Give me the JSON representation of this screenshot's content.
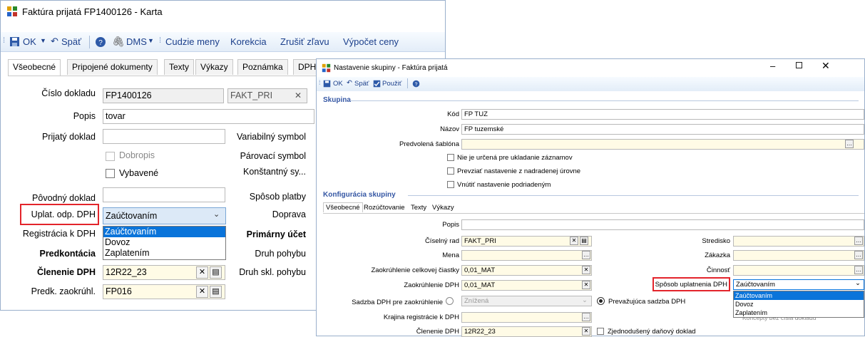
{
  "win1": {
    "title": "Faktúra prijatá FP1400126 - Karta",
    "toolbar": {
      "ok": "OK",
      "back": "Späť",
      "dms": "DMS",
      "foreign": "Cudzie meny",
      "correction": "Korekcia",
      "cancel_discount": "Zrušiť zľavu",
      "calc_price": "Výpočet ceny"
    },
    "tabs": [
      "Všeobecné",
      "Pripojené dokumenty",
      "Texty",
      "Výkazy",
      "Poznámka",
      "DPH"
    ],
    "labels": {
      "doc_no": "Číslo dokladu",
      "desc": "Popis",
      "received": "Prijatý doklad",
      "credit": "Dobropis",
      "settled": "Vybavené",
      "orig": "Pôvodný doklad",
      "vat_claim": "Uplat. odp. DPH",
      "reg": "Registrácia k DPH",
      "precontact": "Predkontácia",
      "vat_split": "Členenie DPH",
      "rounding": "Predk. zaokrúhl.",
      "var_sym": "Variabilný symbol",
      "pair_sym": "Párovací symbol",
      "const_sym": "Konštantný sy...",
      "payment": "Spôsob platby",
      "transport": "Doprava",
      "primary": "Primárny účet",
      "move": "Druh pohybu",
      "stock_move": "Druh skl. pohybu"
    },
    "values": {
      "doc_no": "FP1400126",
      "series": "FAKT_PRI",
      "desc": "tovar",
      "vat_claim": "Zaúčtovaním",
      "vat_split": "12R22_23",
      "rounding": "FP016"
    },
    "dropdown": [
      "Zaúčtovaním",
      "Dovoz",
      "Zaplatením"
    ]
  },
  "win2": {
    "title": "Nastavenie skupiny - Faktúra prijatá",
    "toolbar": {
      "ok": "OK",
      "back": "Späť",
      "apply": "Použiť"
    },
    "group_header": "Skupina",
    "labels": {
      "code": "Kód",
      "name": "Názov",
      "template": "Predvolená šablóna"
    },
    "values": {
      "code": "FP TUZ",
      "name": "FP tuzemské"
    },
    "checks": [
      "Nie je určená pre ukladanie záznamov",
      "Prevziať nastavenie z nadradenej úrovne",
      "Vnútiť nastavenie podriadeným"
    ],
    "config_header": "Konfigurácia skupiny",
    "tabs": [
      "Všeobecné",
      "Rozúčtovanie",
      "Texty",
      "Výkazy"
    ],
    "form": {
      "popis": "Popis",
      "series": "Číselný rad",
      "currency": "Mena",
      "round_total": "Zaokrúhlenie celkovej čiastky",
      "round_vat": "Zaokrúhlenie DPH",
      "vat_rate_round": "Sadzba DPH pre zaokrúhlenie",
      "region": "Krajina registrácie k DPH",
      "vat_split": "Členenie DPH",
      "center": "Stredisko",
      "order": "Zákazka",
      "activity": "Činnosť",
      "vat_claim": "Spôsob uplatnenia DPH"
    },
    "form_values": {
      "series": "FAKT_PRI",
      "round_total": "0,01_MAT",
      "round_vat": "0,01_MAT",
      "reduced": "Znížená",
      "prevailing": "Prevažujúca sadzba DPH",
      "vat_split": "12R22_23",
      "simplified": "Zjednodušený daňový doklad",
      "vat_claim": "Zaúčtovaním",
      "behind": "Koncepty bez čísla dokladu"
    },
    "dropdown": [
      "Zaúčtovaním",
      "Dovoz",
      "Zaplatením"
    ]
  },
  "colors": {
    "accent": "#1b3f8b",
    "highlight": "#0a74da",
    "red": "#e3242b"
  }
}
